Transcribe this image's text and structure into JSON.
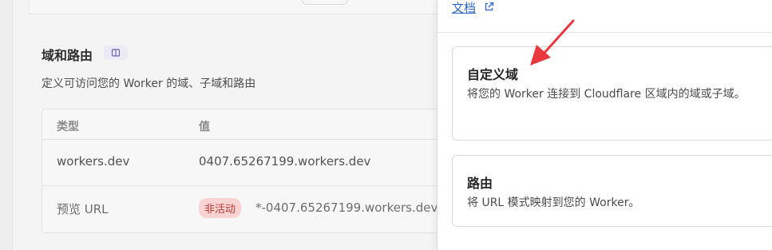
{
  "section": {
    "title": "域和路由",
    "description": "定义可访问您的 Worker 的域、子域和路由"
  },
  "table": {
    "headers": [
      "类型",
      "值"
    ],
    "rows": [
      {
        "type": "workers.dev",
        "value": "0407.65267199.workers.dev"
      },
      {
        "type": "预览 URL",
        "status": "非活动",
        "value": "*-0407.65267199.workers.dev"
      }
    ]
  },
  "drawer": {
    "doc_link": "文档",
    "options": [
      {
        "title": "自定义域",
        "description": "将您的 Worker 连接到 Cloudflare 区域内的域或子域。"
      },
      {
        "title": "路由",
        "description": "将 URL 模式映射到您的 Worker。"
      }
    ]
  },
  "colors": {
    "accent_link": "#2a64c4",
    "inactive_badge_bg": "#f9d3d2",
    "inactive_badge_text": "#b23a37",
    "annotation_arrow": "#e8383d"
  },
  "icons": {
    "section_badge": "book-icon",
    "doc_link": "external-link-icon"
  }
}
